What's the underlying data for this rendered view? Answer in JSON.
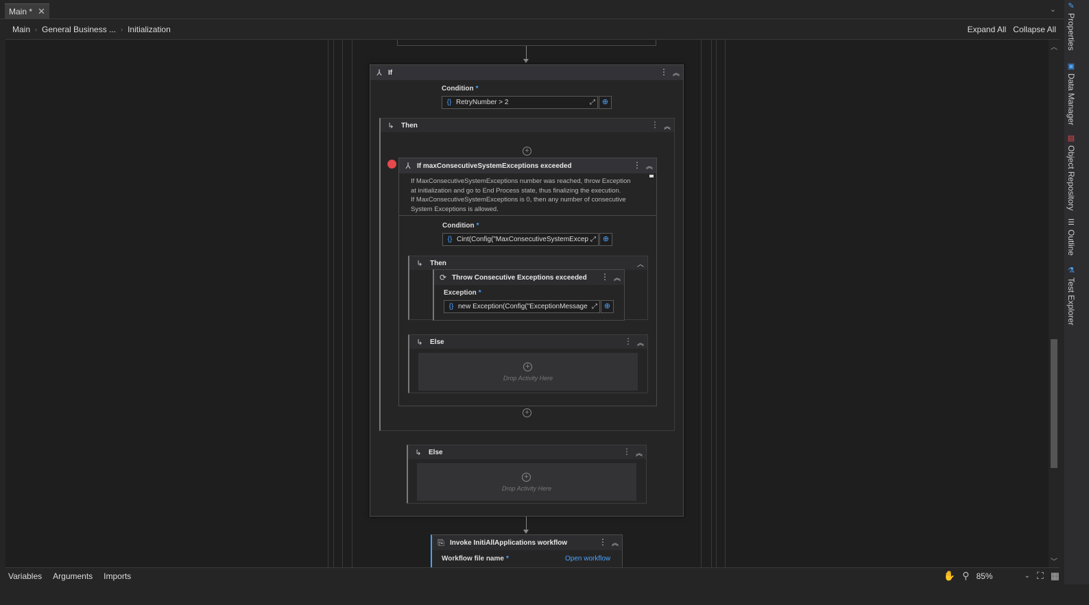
{
  "tabs": {
    "doc_title": "Main *"
  },
  "breadcrumb": {
    "items": [
      "Main",
      "General Business ...",
      "Initialization"
    ],
    "expand_all": "Expand All",
    "collapse_all": "Collapse All"
  },
  "workflow": {
    "outer_if": {
      "title": "If",
      "condition_label": "Condition",
      "condition_value": "RetryNumber > 2",
      "then_label": "Then",
      "else_label": "Else",
      "else_drop": "Drop Activity Here"
    },
    "inner_if": {
      "title": "If maxConsecutiveSystemExceptions exceeded",
      "annotation": [
        "If MaxConsecutiveSystemExceptions number was reached, throw Exception",
        "at initialization and go to End Process state, thus finalizing the execution.",
        "If MaxConsecutiveSystemExceptions is 0, then any number of consecutive",
        "System Exceptions is allowed."
      ],
      "condition_label": "Condition",
      "condition_value": "Cint(Config(\"MaxConsecutiveSystemExcep",
      "then_label": "Then",
      "else_label": "Else",
      "else_drop": "Drop Activity Here"
    },
    "throw": {
      "title": "Throw Consecutive Exceptions exceeded",
      "exception_label": "Exception",
      "exception_value": "new Exception(Config(\"ExceptionMessage"
    },
    "invoke": {
      "title": "Invoke InitiAllApplications workflow",
      "file_label": "Workflow file name",
      "open_link": "Open workflow"
    },
    "required_marker": "*"
  },
  "side_panel": [
    "Properties",
    "Data Manager",
    "Object Repository",
    "Outline",
    "Test Explorer"
  ],
  "bottom": {
    "tabs": [
      "Variables",
      "Arguments",
      "Imports"
    ],
    "zoom": "85%"
  },
  "colors": {
    "accent": "#4aa3ff",
    "breakpoint": "#e5484d",
    "canvas": "#1e1e1f"
  }
}
